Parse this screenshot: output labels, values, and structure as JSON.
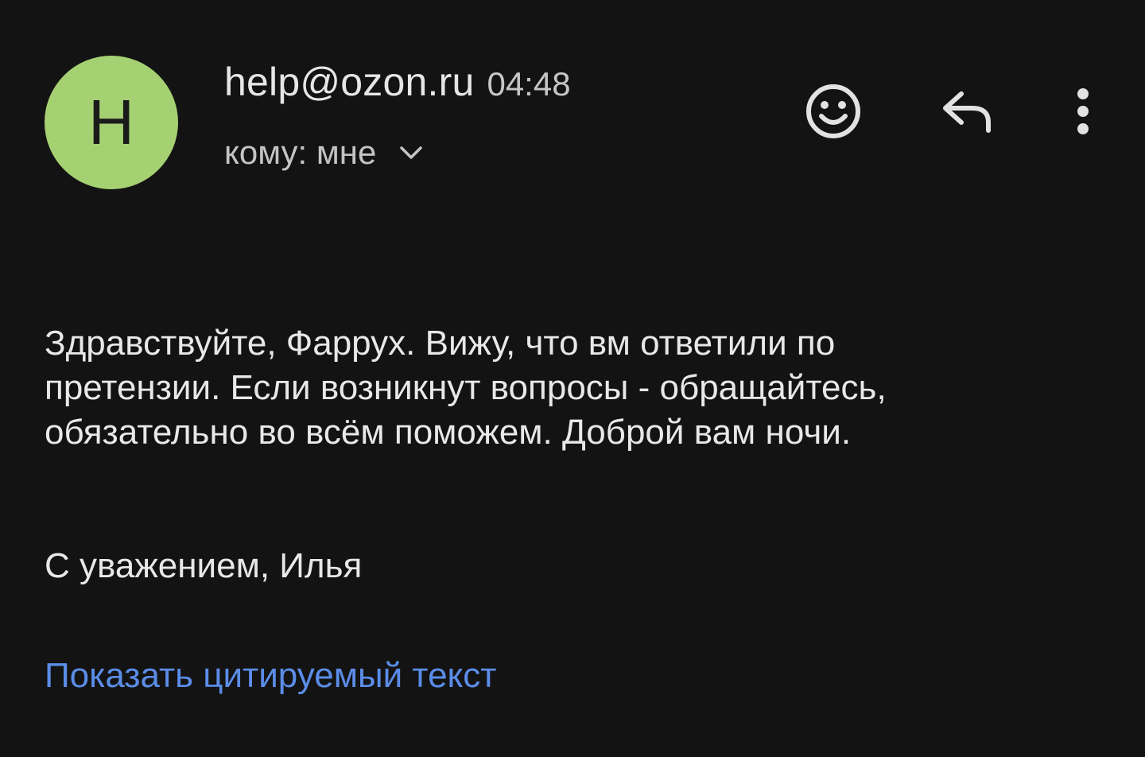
{
  "colors": {
    "background": "#131313",
    "avatar_bg": "#a5d173",
    "link": "#5b8de8",
    "icon": "#e2e2e2"
  },
  "header": {
    "avatar_letter": "H",
    "sender_email": "help@ozon.ru",
    "time": "04:48",
    "recipient_label": "кому: мне"
  },
  "actions": {
    "emoji_icon": "smiley-icon",
    "reply_icon": "reply-icon",
    "more_icon": "more-vert-icon",
    "details_icon": "chevron-down-icon"
  },
  "message": {
    "body": "Здравствуйте, Фаррух. Вижу, что вм ответили по\nпретензии.  Если возникнут вопросы - обращайтесь,\nобязательно во всём поможем. Доброй вам ночи.",
    "signature": "С уважением, Илья",
    "show_quoted_label": "Показать цитируемый текст"
  }
}
